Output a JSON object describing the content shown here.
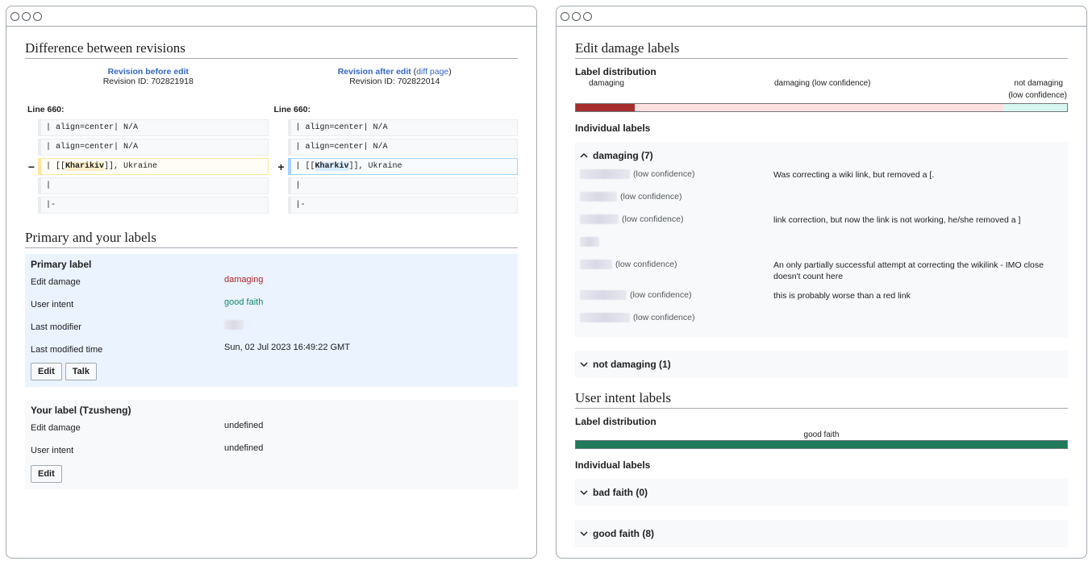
{
  "left": {
    "diff": {
      "heading": "Difference between revisions",
      "before_link": "Revision before edit",
      "before_id": "Revision ID: 702821918",
      "after_link": "Revision after edit",
      "after_diff_open": "(",
      "after_diff_link": "diff page",
      "after_diff_close": ")",
      "after_id": "Revision ID: 702822014",
      "line_left": "Line 660:",
      "line_right": "Line 660:",
      "rows": [
        {
          "left": "| align=center| N/A",
          "right": "| align=center| N/A"
        },
        {
          "left": "| align=center| N/A",
          "right": "| align=center| N/A"
        },
        {
          "left_pre": "| [[",
          "left_hl": "Kharikiv",
          "left_post": "]], Ukraine",
          "right_pre": "| [[",
          "right_hl": "Kharkiv",
          "right_post": "]], Ukraine",
          "minus": "−",
          "plus": "+"
        },
        {
          "left": "|",
          "right": "|"
        },
        {
          "left": "|-",
          "right": "|-"
        }
      ]
    },
    "labels": {
      "heading": "Primary and your labels",
      "primary": {
        "title": "Primary label",
        "edit_damage_k": "Edit damage",
        "edit_damage_v": "damaging",
        "user_intent_k": "User intent",
        "user_intent_v": "good faith",
        "last_modifier_k": "Last modifier",
        "last_modified_k": "Last modified time",
        "last_modified_v": "Sun, 02 Jul 2023 16:49:22 GMT",
        "edit_btn": "Edit",
        "talk_btn": "Talk"
      },
      "yours": {
        "title": "Your label (Tzusheng)",
        "edit_damage_k": "Edit damage",
        "edit_damage_v": "undefined",
        "user_intent_k": "User intent",
        "user_intent_v": "undefined",
        "edit_btn": "Edit"
      }
    }
  },
  "right": {
    "damage": {
      "heading": "Edit damage labels",
      "dist_title": "Label distribution",
      "dist_damaging": "damaging",
      "dist_low": "damaging (low confidence)",
      "dist_not_1": "not damaging",
      "dist_not_2": "(low confidence)",
      "individual_title": "Individual labels",
      "acc_damaging": "damaging (7)",
      "acc_not_damaging": "not damaging (1)",
      "rows": [
        {
          "conf": "(low confidence)",
          "comment": "Was correcting a wiki link, but removed a [."
        },
        {
          "conf": "(low confidence)",
          "comment": ""
        },
        {
          "conf": "(low confidence)",
          "comment": "link correction, but now the link is not working, he/she removed a ]"
        },
        {
          "conf": "",
          "comment": ""
        },
        {
          "conf": "(low confidence)",
          "comment": "An only partially successful attempt at correcting the wikilink - IMO close doesn't count here"
        },
        {
          "conf": "(low confidence)",
          "comment": "this is probably worse than a red link"
        },
        {
          "conf": "(low confidence)",
          "comment": ""
        }
      ],
      "distribution": {
        "damaging": 0.12,
        "damaging_low": 0.75,
        "not_damaging_low": 0.13
      }
    },
    "intent": {
      "heading": "User intent labels",
      "dist_title": "Label distribution",
      "dist_good": "good faith",
      "individual_title": "Individual labels",
      "acc_bad": "bad faith (0)",
      "acc_good": "good faith (8)",
      "distribution": {
        "good_faith": 1.0
      }
    }
  },
  "colors": {
    "damaging": "#a72e2e",
    "damaging_low": "#ffe1e1",
    "not_damaging_low": "#d9f7f1",
    "good_faith": "#1e7a5a",
    "damaging_text": "#b32424",
    "good_text": "#14866d"
  },
  "icons": {
    "chevron_up": "chevron-up-icon",
    "chevron_down": "chevron-down-icon",
    "window_dot": "window-control-icon"
  }
}
